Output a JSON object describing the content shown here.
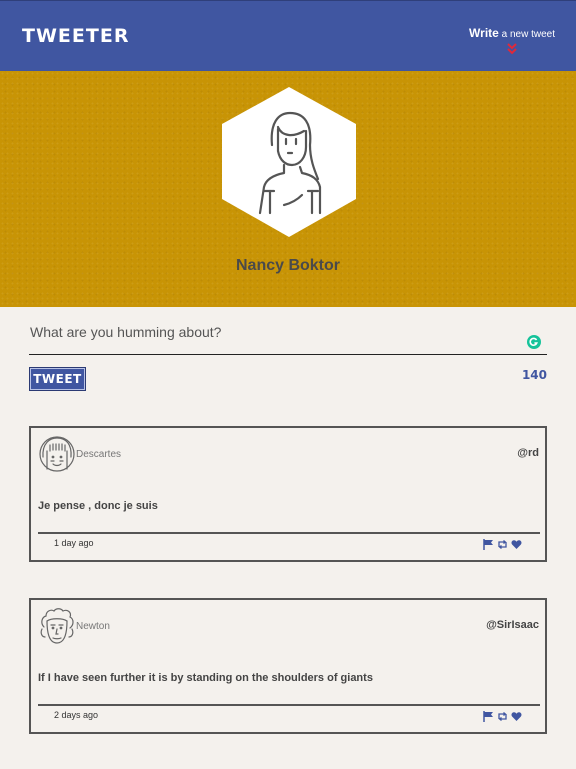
{
  "nav": {
    "brand": "TWEETER",
    "write_bold": "Write",
    "write_rest": " a new tweet",
    "accent": "#4056a1",
    "chevron_color": "#e0293a"
  },
  "profile": {
    "name": "Nancy Boktor",
    "banner_color": "#c89405"
  },
  "compose": {
    "placeholder": "What are you humming about?",
    "button_label": "TWEET",
    "char_count": "140"
  },
  "tweets": [
    {
      "name": "Descartes",
      "handle": "@rd",
      "text": "Je pense , donc je suis",
      "age": "1 day ago",
      "actions": [
        "flag-icon",
        "retweet-icon",
        "heart-icon"
      ]
    },
    {
      "name": "Newton",
      "handle": "@SirIsaac",
      "text": "If I have seen further it is by standing on the shoulders of giants",
      "age": "2 days ago",
      "actions": [
        "flag-icon",
        "retweet-icon",
        "heart-icon"
      ]
    }
  ]
}
